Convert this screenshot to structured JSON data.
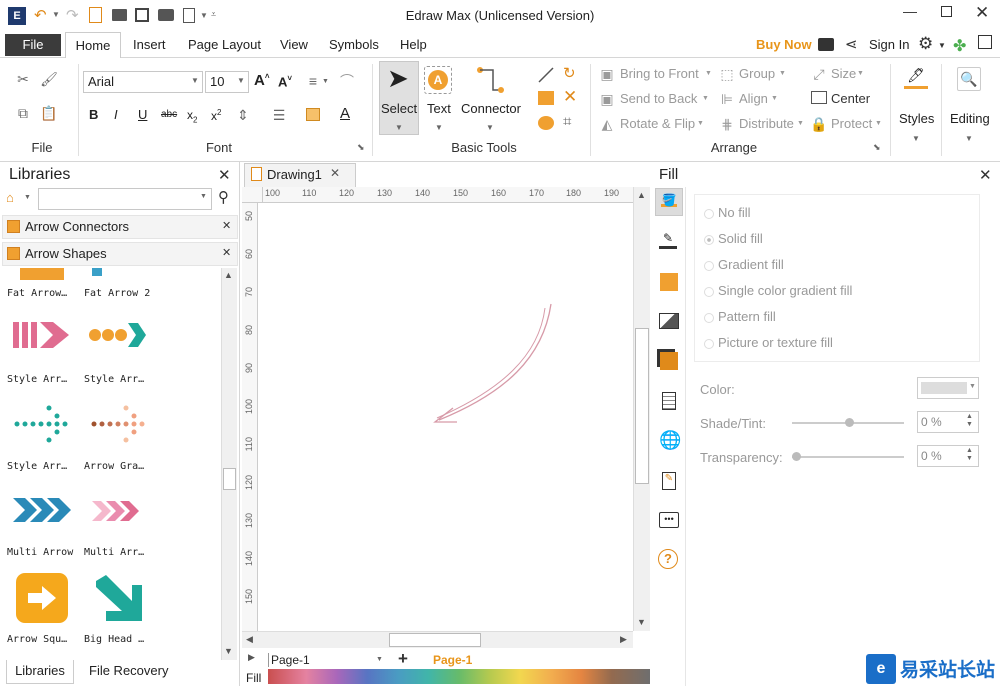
{
  "window": {
    "title": "Edraw Max (Unlicensed Version)"
  },
  "menu": {
    "file": "File",
    "tabs": [
      "Home",
      "Insert",
      "Page Layout",
      "View",
      "Symbols",
      "Help"
    ],
    "buy_now": "Buy Now",
    "sign_in": "Sign In"
  },
  "ribbon": {
    "file_group": "File",
    "font_group": "Font",
    "font_name": "Arial",
    "font_size": "10",
    "basic_tools_group": "Basic Tools",
    "select": "Select",
    "text": "Text",
    "connector": "Connector",
    "arrange_group": "Arrange",
    "bring_to_front": "Bring to Front",
    "send_to_back": "Send to Back",
    "rotate_flip": "Rotate & Flip",
    "group": "Group",
    "align": "Align",
    "distribute": "Distribute",
    "size": "Size",
    "center": "Center",
    "protect": "Protect",
    "styles": "Styles",
    "editing": "Editing"
  },
  "libraries": {
    "title": "Libraries",
    "categories": [
      "Arrow Connectors",
      "Arrow Shapes"
    ],
    "shapes": [
      [
        "Fat Arrow…",
        "Fat Arrow 2"
      ],
      [
        "Style Arr…",
        "Style Arr…"
      ],
      [
        "Style Arr…",
        "Arrow Gra…"
      ],
      [
        "Multi Arrow",
        "Multi Arr…"
      ],
      [
        "Arrow Squ…",
        "Big Head …"
      ]
    ],
    "bottom_tabs": [
      "Libraries",
      "File Recovery"
    ]
  },
  "canvas": {
    "tab": "Drawing1",
    "h_ruler": [
      "100",
      "110",
      "120",
      "130",
      "140",
      "150",
      "160",
      "170",
      "180",
      "190"
    ],
    "v_ruler": [
      "50",
      "60",
      "70",
      "80",
      "90",
      "100",
      "110",
      "120",
      "130",
      "140",
      "150"
    ],
    "page_select": "Page-1",
    "page_tab": "Page-1",
    "fill_label": "Fill"
  },
  "fill_panel": {
    "title": "Fill",
    "options": [
      "No fill",
      "Solid fill",
      "Gradient fill",
      "Single color gradient fill",
      "Pattern fill",
      "Picture or texture fill"
    ],
    "color_label": "Color:",
    "shade_label": "Shade/Tint:",
    "shade_value": "0 %",
    "transparency_label": "Transparency:",
    "transparency_value": "0 %"
  },
  "watermark": {
    "text": "易采站长站"
  },
  "colors": {
    "orange": "#f0a030",
    "pink": "#e06c90",
    "teal": "#1fa89a",
    "blue": "#3aa0c8",
    "accent": "#e8951a"
  }
}
